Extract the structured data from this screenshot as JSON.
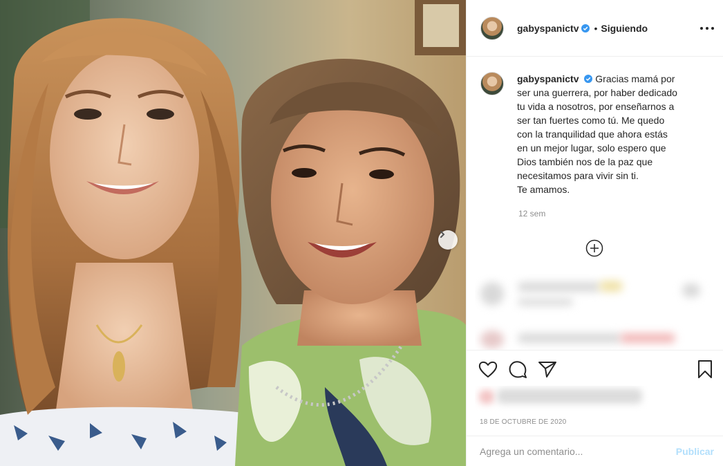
{
  "post": {
    "username": "gabyspanictv",
    "follow_status": "Siguiendo",
    "separator": "•",
    "caption": {
      "username": "gabyspanictv",
      "lines": [
        "Gracias mamá por",
        "ser una guerrera, por haber dedicado",
        "tu vida a nosotros, por enseñarnos a",
        "ser tan fuertes como tú. Me quedo",
        "con la tranquilidad que ahora estás",
        "en un mejor lugar, solo espero que",
        "Dios también nos de la paz que",
        "necesitamos para vivir sin ti.",
        "Te amamos."
      ],
      "time_ago": "12 sem"
    },
    "date": "18 DE OCTUBRE DE 2020",
    "comment": {
      "placeholder": "Agrega un comentario...",
      "publish_label": "Publicar"
    }
  },
  "icons": {
    "verified": "verified-badge-icon",
    "more": "more-options-icon",
    "load_more": "plus-circle-icon",
    "like": "heart-icon",
    "comment": "comment-bubble-icon",
    "share": "paper-plane-icon",
    "save": "bookmark-icon",
    "carousel_next": "chevron-right-icon"
  },
  "colors": {
    "verified": "#3897f0",
    "publish_disabled": "#b2dffc",
    "secondary_text": "#8e8e8e"
  }
}
